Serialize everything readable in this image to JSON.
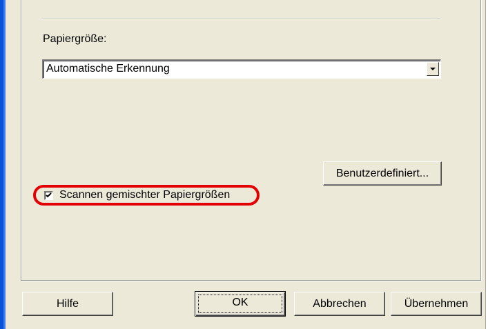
{
  "paper_size": {
    "label": "Papiergröße:",
    "selected": "Automatische Erkennung"
  },
  "custom_button": "Benutzerdefiniert...",
  "mixed_sizes": {
    "label": "Scannen gemischter Papiergrößen",
    "checked": true
  },
  "footer": {
    "help": "Hilfe",
    "ok": "OK",
    "cancel": "Abbrechen",
    "apply": "Übernehmen"
  },
  "colors": {
    "dialog_bg": "#ece9d8",
    "highlight": "#e30000",
    "window_border": "#0a53d8"
  }
}
